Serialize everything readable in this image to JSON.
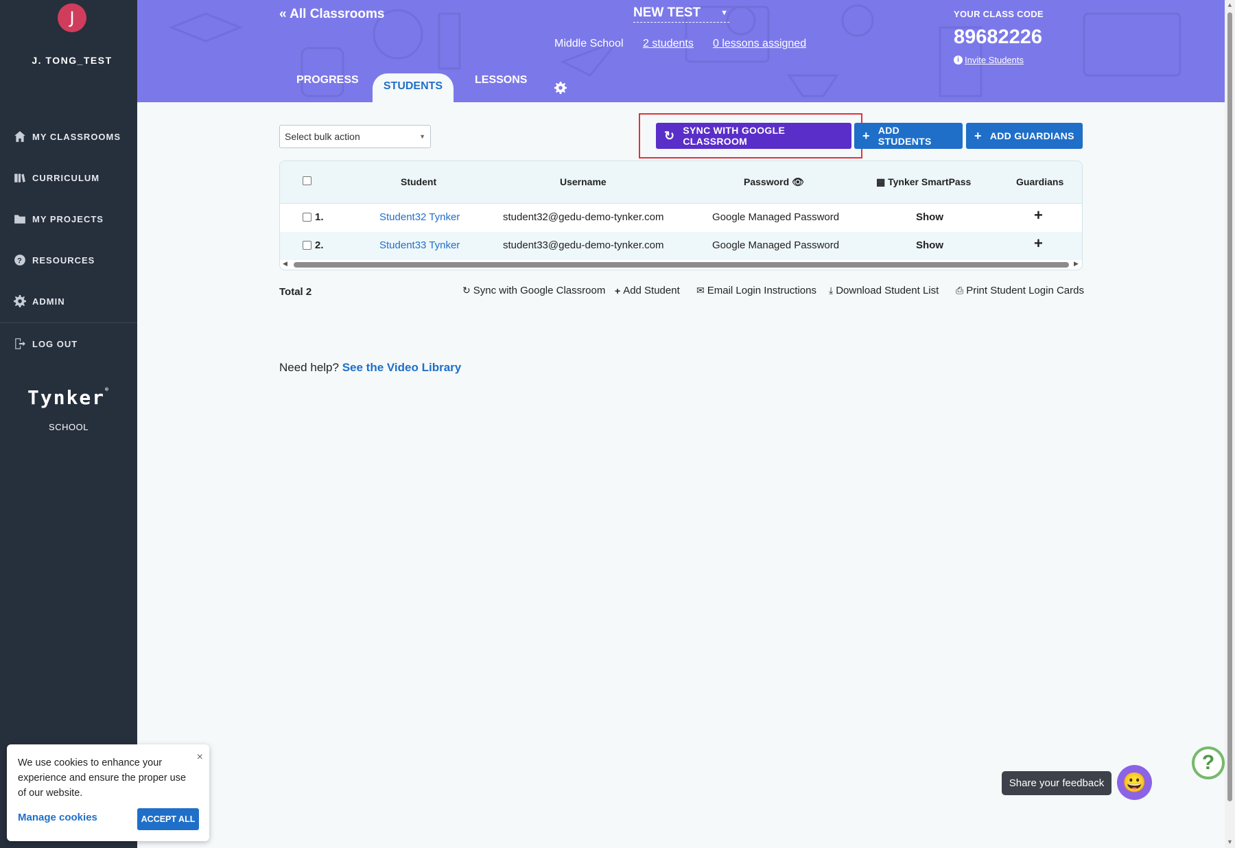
{
  "sidebar": {
    "avatar_letter": "J",
    "username": "J. TONG_TEST",
    "items": [
      {
        "label": "MY CLASSROOMS",
        "icon": "home-icon"
      },
      {
        "label": "CURRICULUM",
        "icon": "books-icon"
      },
      {
        "label": "MY PROJECTS",
        "icon": "folder-icon"
      },
      {
        "label": "RESOURCES",
        "icon": "question-icon"
      },
      {
        "label": "ADMIN",
        "icon": "gear-icon"
      },
      {
        "label": "LOG OUT",
        "icon": "logout-icon"
      }
    ],
    "logo_text": "Tynker",
    "logo_sub": "SCHOOL"
  },
  "header": {
    "back_link": "« All Classrooms",
    "class_name": "NEW TEST",
    "grade": "Middle School",
    "students_link": "2 students",
    "lessons_link": "0 lessons assigned",
    "class_code_label": "YOUR CLASS CODE",
    "class_code": "89682226",
    "invite_link": "Invite Students",
    "tabs": [
      {
        "label": "PROGRESS"
      },
      {
        "label": "STUDENTS",
        "active": true
      },
      {
        "label": "LESSONS"
      }
    ]
  },
  "toolbar": {
    "bulk_placeholder": "Select bulk action",
    "sync_label": "SYNC WITH GOOGLE CLASSROOM",
    "add_students_label": "ADD STUDENTS",
    "add_guardians_label": "ADD GUARDIANS"
  },
  "table": {
    "columns": [
      "Student",
      "Username",
      "Password",
      "Tynker SmartPass",
      "Guardians"
    ],
    "rows": [
      {
        "num": "1.",
        "student": "Student32 Tynker",
        "username": "student32@gedu-demo-tynker.com",
        "password": "Google Managed Password",
        "smartpass": "Show",
        "guardians": "+"
      },
      {
        "num": "2.",
        "student": "Student33 Tynker",
        "username": "student33@gedu-demo-tynker.com",
        "password": "Google Managed Password",
        "smartpass": "Show",
        "guardians": "+"
      }
    ]
  },
  "footer_actions": {
    "total": "Total 2",
    "sync": "Sync with Google Classroom",
    "add_student": "Add Student",
    "email": "Email Login Instructions",
    "download": "Download Student List",
    "print": "Print Student Login Cards"
  },
  "help": {
    "prefix": "Need help?",
    "link": "See the Video Library"
  },
  "cookie": {
    "text": "We use cookies to enhance your experience and ensure the proper use of our website.",
    "manage": "Manage cookies",
    "accept": "ACCEPT ALL",
    "close": "×"
  },
  "feedback": {
    "label": "Share your feedback"
  },
  "colors": {
    "sidebar": "#262f3c",
    "header": "#7b79e9",
    "accent": "#1f6fc9",
    "sync_button": "#5a2ec9",
    "highlight": "#e4303a"
  }
}
